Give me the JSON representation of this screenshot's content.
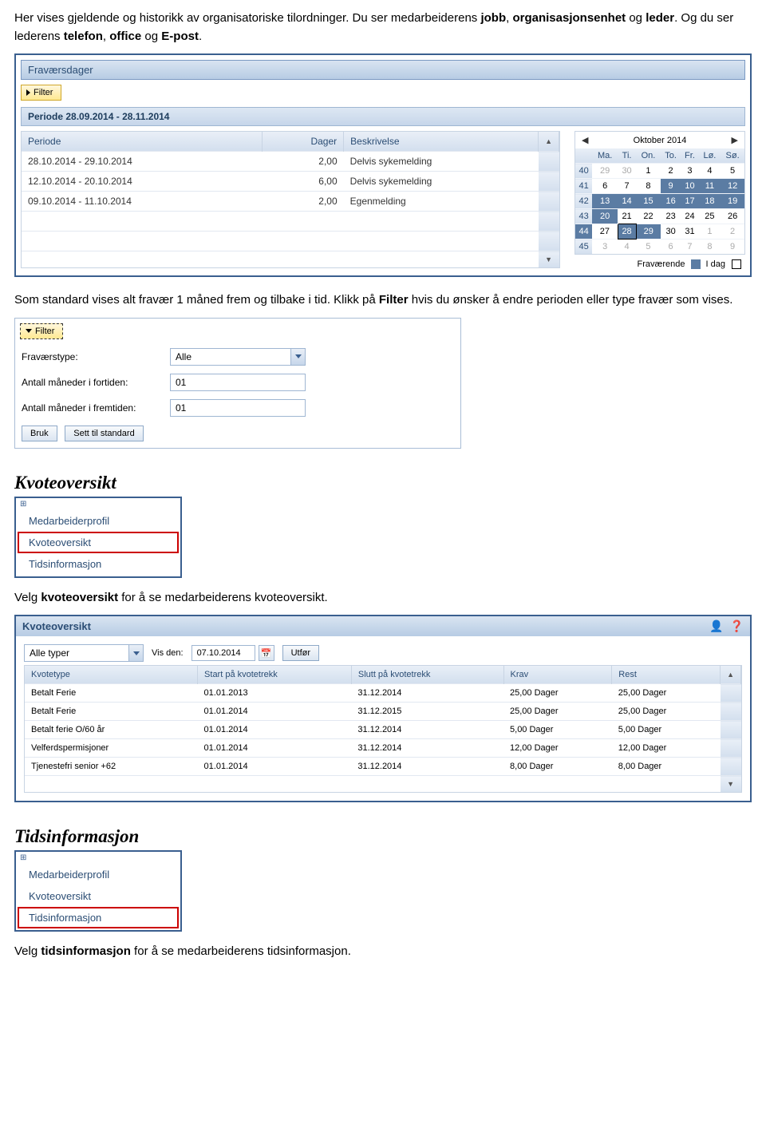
{
  "intro": {
    "part1": "Her vises gjeldende og historikk av organisatoriske tilordninger. Du ser medarbeiderens ",
    "b1": "jobb",
    "part2": ", ",
    "b2": "organisasjonsenhet",
    "part3": " og ",
    "b3": "leder",
    "part4": ". Og du ser lederens ",
    "b4": "telefon",
    "part5": ", ",
    "b5": "office",
    "part6": " og ",
    "b6": "E-post",
    "part7": "."
  },
  "absence": {
    "title": "Fraværsdager",
    "filter_btn": "Filter",
    "period_header": "Periode 28.09.2014 - 28.11.2014",
    "cols": {
      "period": "Periode",
      "days": "Dager",
      "desc": "Beskrivelse"
    },
    "rows": [
      {
        "period": "28.10.2014 - 29.10.2014",
        "days": "2,00",
        "desc": "Delvis sykemelding"
      },
      {
        "period": "12.10.2014 - 20.10.2014",
        "days": "6,00",
        "desc": "Delvis sykemelding"
      },
      {
        "period": "09.10.2014 - 11.10.2014",
        "days": "2,00",
        "desc": "Egenmelding"
      }
    ],
    "calendar": {
      "month": "Oktober 2014",
      "days_hdr": [
        "",
        "Ma.",
        "Ti.",
        "On.",
        "To.",
        "Fr.",
        "Lø.",
        "Sø."
      ],
      "weeks": [
        {
          "wk": "40",
          "d": [
            {
              "v": "29",
              "dim": true
            },
            {
              "v": "30",
              "dim": true
            },
            {
              "v": "1"
            },
            {
              "v": "2"
            },
            {
              "v": "3"
            },
            {
              "v": "4"
            },
            {
              "v": "5"
            }
          ]
        },
        {
          "wk": "41",
          "d": [
            {
              "v": "6"
            },
            {
              "v": "7"
            },
            {
              "v": "8"
            },
            {
              "v": "9",
              "abs": true
            },
            {
              "v": "10",
              "abs": true
            },
            {
              "v": "11",
              "abs": true
            },
            {
              "v": "12",
              "abs": true
            }
          ]
        },
        {
          "wk": "42",
          "d": [
            {
              "v": "13",
              "abs": true
            },
            {
              "v": "14",
              "abs": true
            },
            {
              "v": "15",
              "abs": true
            },
            {
              "v": "16",
              "abs": true
            },
            {
              "v": "17",
              "abs": true
            },
            {
              "v": "18",
              "abs": true
            },
            {
              "v": "19",
              "abs": true
            }
          ]
        },
        {
          "wk": "43",
          "d": [
            {
              "v": "20",
              "abs": true
            },
            {
              "v": "21"
            },
            {
              "v": "22"
            },
            {
              "v": "23"
            },
            {
              "v": "24"
            },
            {
              "v": "25"
            },
            {
              "v": "26"
            }
          ]
        },
        {
          "wk": "44",
          "d": [
            {
              "v": "27"
            },
            {
              "v": "28",
              "abs": true,
              "today": true
            },
            {
              "v": "29",
              "abs": true
            },
            {
              "v": "30"
            },
            {
              "v": "31"
            },
            {
              "v": "1",
              "dim": true
            },
            {
              "v": "2",
              "dim": true
            }
          ]
        },
        {
          "wk": "45",
          "d": [
            {
              "v": "3",
              "dim": true
            },
            {
              "v": "4",
              "dim": true
            },
            {
              "v": "5",
              "dim": true
            },
            {
              "v": "6",
              "dim": true
            },
            {
              "v": "7",
              "dim": true
            },
            {
              "v": "8",
              "dim": true
            },
            {
              "v": "9",
              "dim": true
            }
          ]
        }
      ],
      "legend_absent": "Fraværende",
      "legend_today": "I dag"
    }
  },
  "mid_text": {
    "part1": "Som standard vises alt fravær 1 måned frem og tilbake i tid. Klikk på ",
    "b1": "Filter",
    "part2": " hvis du ønsker å endre perioden eller type fravær som vises."
  },
  "filter_form": {
    "filter_btn": "Filter",
    "type_label": "Fraværstype:",
    "type_value": "Alle",
    "past_label": "Antall måneder i fortiden:",
    "past_value": "01",
    "future_label": "Antall måneder i fremtiden:",
    "future_value": "01",
    "apply": "Bruk",
    "reset": "Sett til standard"
  },
  "kvote": {
    "heading": "Kvoteoversikt",
    "menu": {
      "m1": "Medarbeiderprofil",
      "m2": "Kvoteoversikt",
      "m3": "Tidsinformasjon"
    },
    "desc_p1": "Velg ",
    "desc_b": "kvoteoversikt",
    "desc_p2": " for å se medarbeiderens kvoteoversikt.",
    "panel_title": "Kvoteoversikt",
    "type_value": "Alle typer",
    "vis_label": "Vis den:",
    "vis_date": "07.10.2014",
    "exec": "Utfør",
    "cols": {
      "type": "Kvotetype",
      "start": "Start på kvotetrekk",
      "end": "Slutt på kvotetrekk",
      "krav": "Krav",
      "rest": "Rest"
    },
    "rows": [
      {
        "type": "Betalt Ferie",
        "start": "01.01.2013",
        "end": "31.12.2014",
        "krav": "25,00 Dager",
        "rest": "25,00 Dager"
      },
      {
        "type": "Betalt Ferie",
        "start": "01.01.2014",
        "end": "31.12.2015",
        "krav": "25,00 Dager",
        "rest": "25,00 Dager"
      },
      {
        "type": "Betalt ferie O/60 år",
        "start": "01.01.2014",
        "end": "31.12.2014",
        "krav": "5,00 Dager",
        "rest": "5,00 Dager"
      },
      {
        "type": "Velferdspermisjoner",
        "start": "01.01.2014",
        "end": "31.12.2014",
        "krav": "12,00 Dager",
        "rest": "12,00 Dager"
      },
      {
        "type": "Tjenestefri senior +62",
        "start": "01.01.2014",
        "end": "31.12.2014",
        "krav": "8,00 Dager",
        "rest": "8,00 Dager"
      }
    ]
  },
  "tids": {
    "heading": "Tidsinformasjon",
    "menu": {
      "m1": "Medarbeiderprofil",
      "m2": "Kvoteoversikt",
      "m3": "Tidsinformasjon"
    },
    "desc_p1": "Velg ",
    "desc_b": "tidsinformasjon",
    "desc_p2": " for å se medarbeiderens tidsinformasjon."
  }
}
